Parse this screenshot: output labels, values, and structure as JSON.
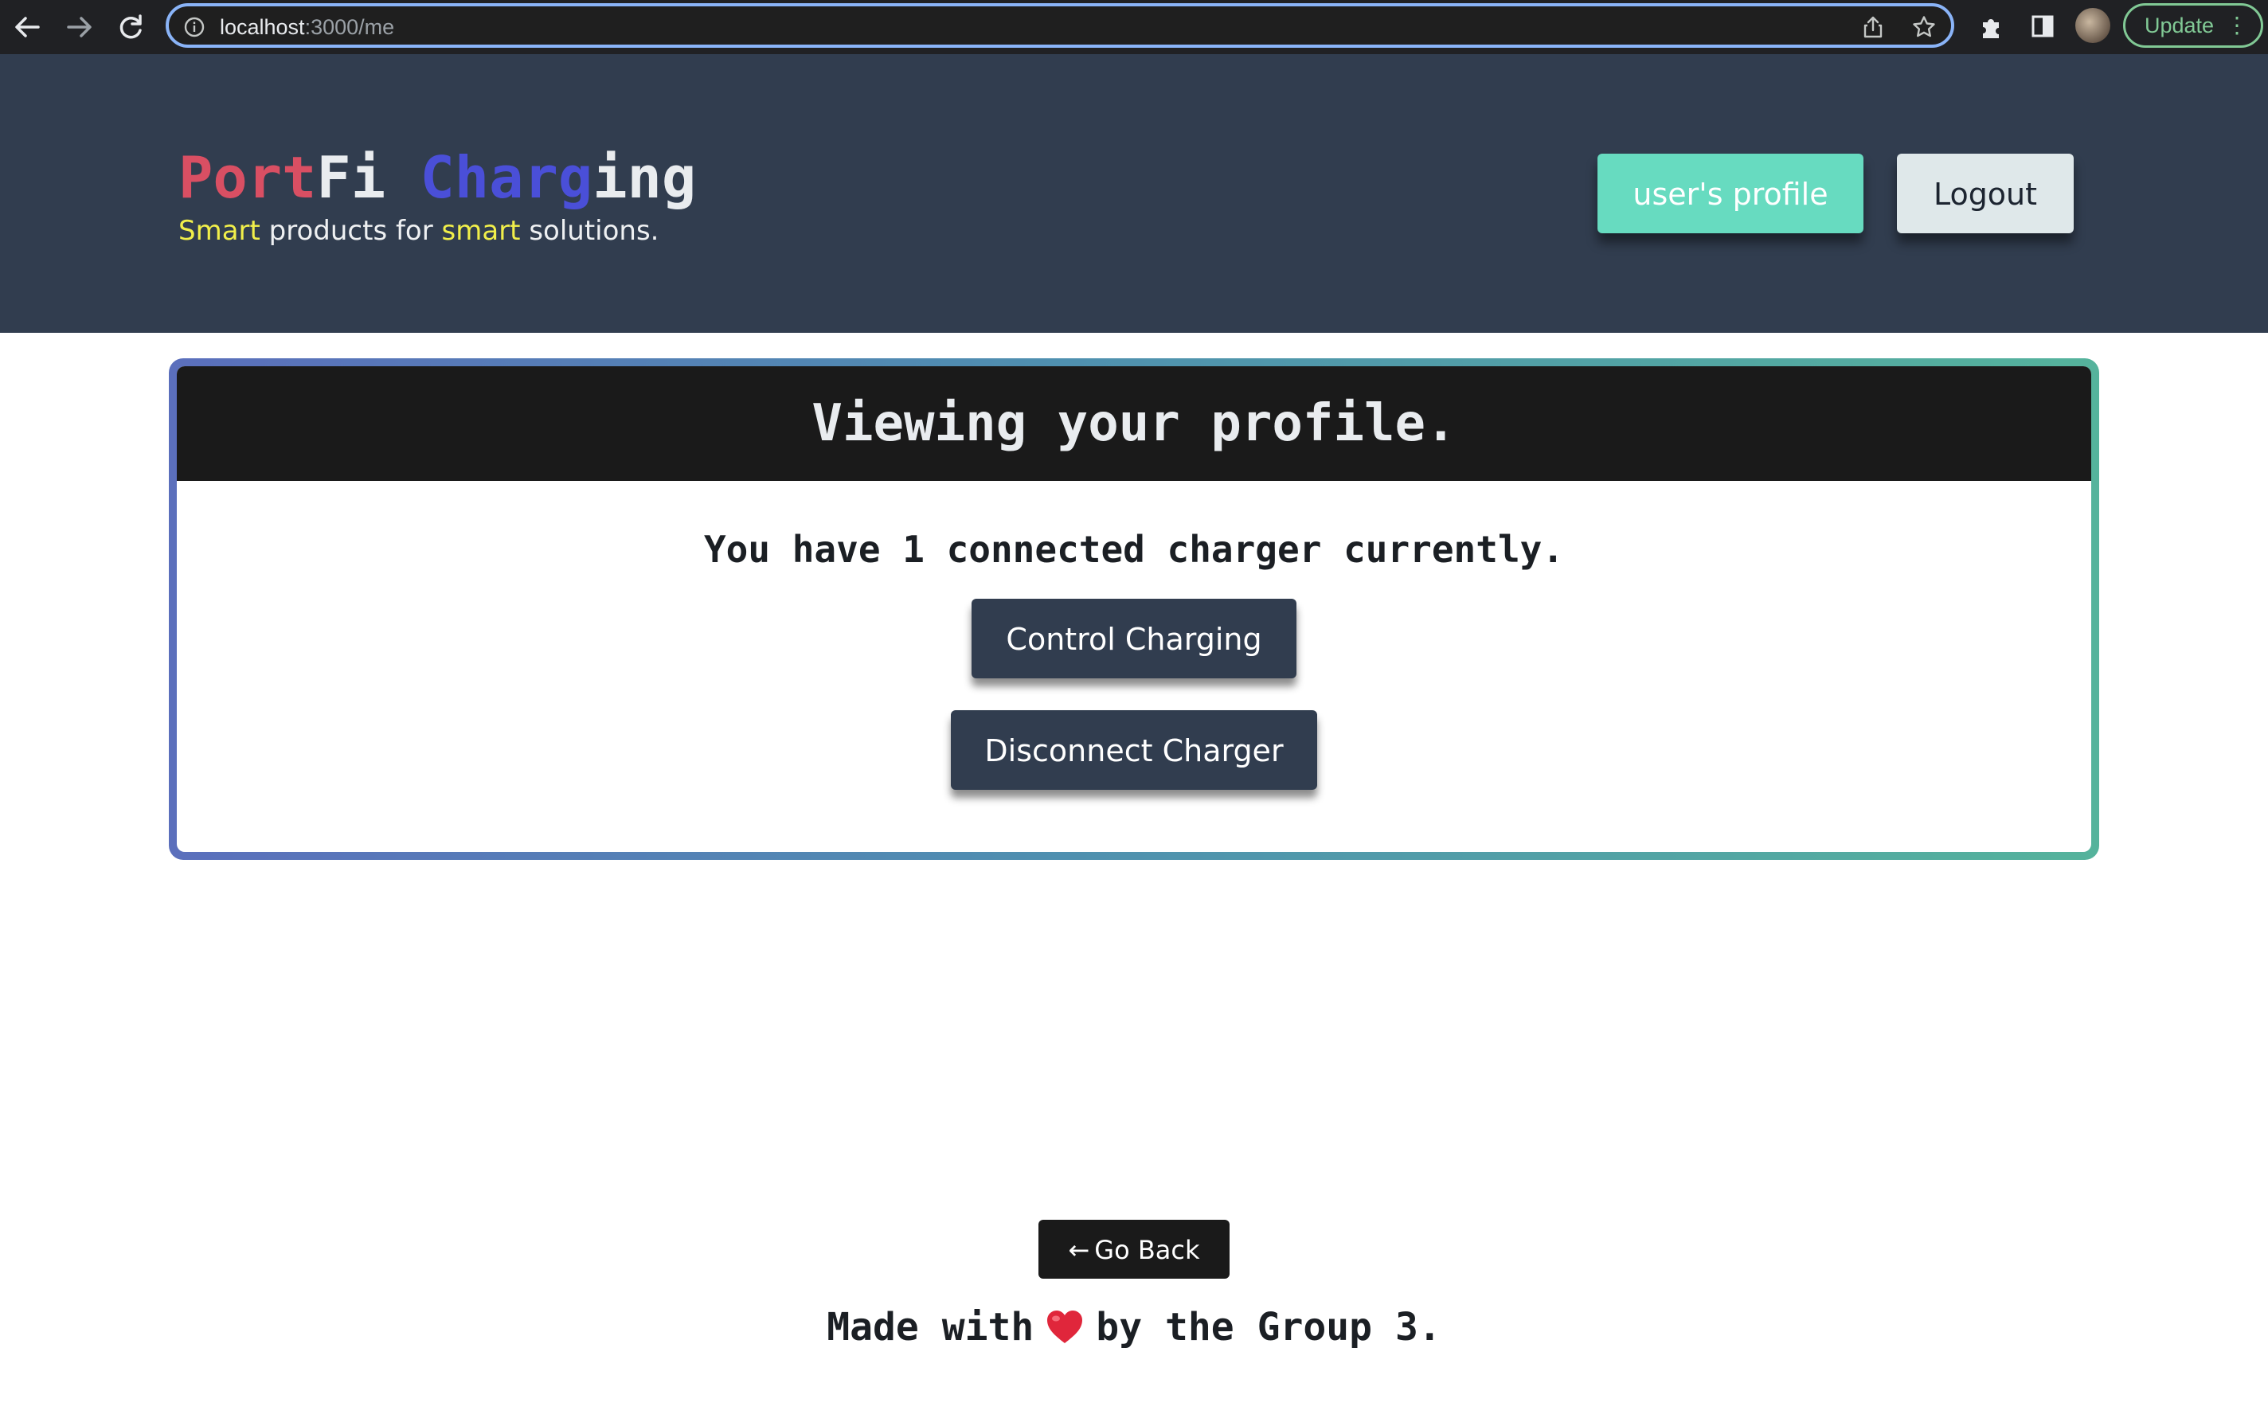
{
  "browser": {
    "url_host": "localhost",
    "url_path": ":3000/me",
    "update_label": "Update",
    "icons": [
      "back-arrow-icon",
      "forward-arrow-icon",
      "reload-icon",
      "site-info-icon",
      "share-icon",
      "bookmark-star-icon",
      "extensions-puzzle-icon",
      "side-panel-icon",
      "profile-avatar",
      "more-menu-icon"
    ],
    "accent_color": "#8ab4f8"
  },
  "header": {
    "brand_part1": "Port",
    "brand_part2": "Fi",
    "brand_part3": "Charg",
    "brand_part4": "ing",
    "tagline_word1": "Smart",
    "tagline_mid": " products for ",
    "tagline_word2": "smart",
    "tagline_end": " solutions.",
    "profile_button": "user's profile",
    "logout_button": "Logout",
    "colors": {
      "background": "#313d4f",
      "brand_red": "#d94f63",
      "brand_blue": "#4a4fd8",
      "highlight_yellow": "#f1ef4a",
      "profile_button": "#67dbc0"
    }
  },
  "profile_card": {
    "title": "Viewing your profile.",
    "message": "You have 1 connected charger currently.",
    "control_button": "Control Charging",
    "disconnect_button": "Disconnect Charger",
    "border_gradient": [
      "#5b6fbc",
      "#55b39c"
    ]
  },
  "footer": {
    "back_button_arrow": "←",
    "back_button": "Go Back",
    "made_with": "Made with",
    "by_text": "by the Group 3.",
    "heart_icon": "heart-icon"
  }
}
